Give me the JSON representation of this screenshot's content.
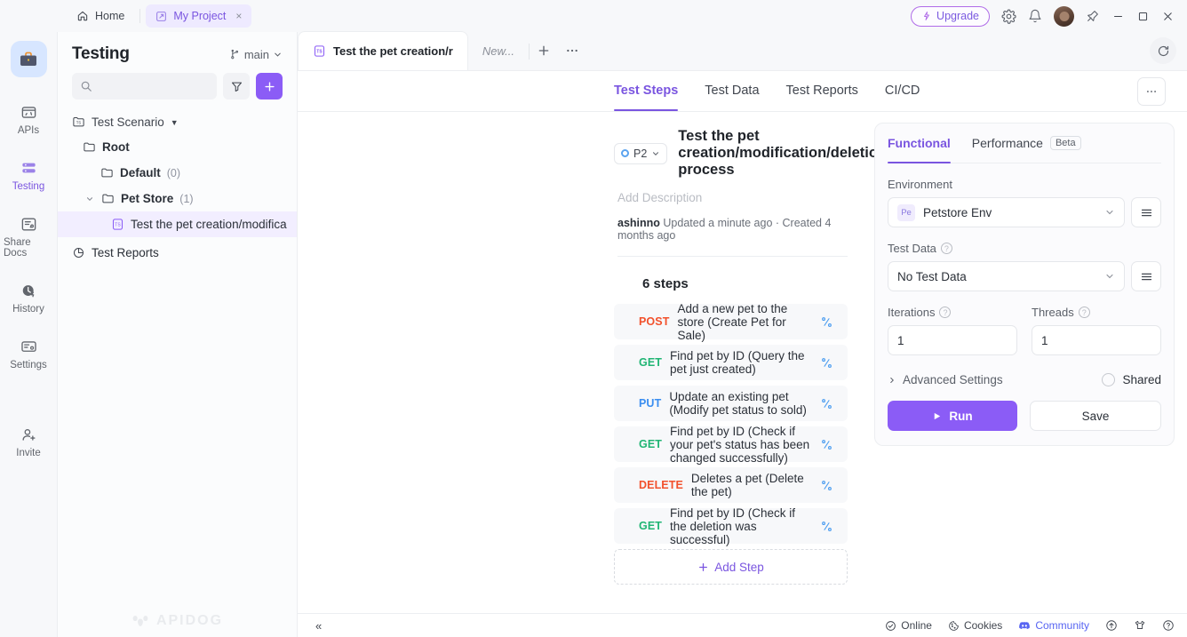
{
  "titlebar": {
    "home_label": "Home",
    "project_tab": "My Project",
    "close_label": "×",
    "upgrade_label": "Upgrade",
    "icons": {
      "settings": "gear-icon",
      "notifications": "bell-icon",
      "pin": "pin-icon"
    },
    "window": {
      "minimize": "−",
      "maximize": "□",
      "close": "✕"
    }
  },
  "rail": {
    "logo": "briefcase-icon",
    "items": [
      {
        "label": "APIs",
        "icon": "api-icon",
        "active": false
      },
      {
        "label": "Testing",
        "icon": "testing-icon",
        "active": true
      },
      {
        "label": "Share Docs",
        "icon": "share-docs-icon",
        "active": false
      },
      {
        "label": "History",
        "icon": "history-icon",
        "active": false
      },
      {
        "label": "Settings",
        "icon": "settings-icon",
        "active": false
      },
      {
        "label": "Invite",
        "icon": "invite-icon",
        "active": false
      }
    ]
  },
  "sidebar": {
    "title": "Testing",
    "branch": "main",
    "search_placeholder": "",
    "filter_icon": "filter-icon",
    "add_label": "+",
    "section": "Test Scenario",
    "tree": [
      {
        "label": "Root",
        "count": "",
        "indent": 1,
        "caret": "",
        "selected": false,
        "icon": "folder-icon"
      },
      {
        "label": "Default",
        "count": "(0)",
        "indent": 2,
        "caret": "",
        "selected": false,
        "icon": "folder-icon"
      },
      {
        "label": "Pet Store",
        "count": "(1)",
        "indent": 2,
        "caret": "⌄",
        "selected": false,
        "icon": "folder-icon"
      },
      {
        "label": "Test the pet creation/modifica",
        "count": "",
        "indent": 3,
        "caret": "",
        "selected": true,
        "icon": "test-scenario-icon"
      }
    ],
    "reports": "Test Reports",
    "watermark": "APIDOG"
  },
  "doc_tabs": {
    "tabs": [
      {
        "label": "Test the pet creation/r",
        "active": true
      },
      {
        "label": "New...",
        "active": false
      }
    ],
    "new_tab": "+",
    "more": "···",
    "refresh_icon": "refresh-icon"
  },
  "subtabs": {
    "items": [
      {
        "label": "Test Steps",
        "active": true
      },
      {
        "label": "Test Data",
        "active": false
      },
      {
        "label": "Test Reports",
        "active": false
      },
      {
        "label": "CI/CD",
        "active": false
      }
    ],
    "more": "···"
  },
  "scenario": {
    "priority": "P2",
    "title": "Test the pet creation/modification/deletion process",
    "description_placeholder": "Add Description",
    "author": "ashinno",
    "meta": "Updated a minute ago · Created 4 months ago",
    "steps_count": "6 steps",
    "add_step": "Add Step",
    "steps": [
      {
        "verb": "POST",
        "color": "#f2512c",
        "desc": "Add a new pet to the store (Create Pet for Sale)"
      },
      {
        "verb": "GET",
        "color": "#20b574",
        "desc": "Find pet by ID (Query the pet just created)"
      },
      {
        "verb": "PUT",
        "color": "#3b8ef0",
        "desc": "Update an existing pet (Modify pet status to sold)"
      },
      {
        "verb": "GET",
        "color": "#20b574",
        "desc": "Find pet by ID (Check if your pet's status has been changed successfully)"
      },
      {
        "verb": "DELETE",
        "color": "#f2512c",
        "desc": "Deletes a pet (Delete the pet)"
      },
      {
        "verb": "GET",
        "color": "#20b574",
        "desc": "Find pet by ID (Check if the deletion was successful)"
      }
    ]
  },
  "runpanel": {
    "tabs": [
      {
        "label": "Functional",
        "active": true,
        "badge": ""
      },
      {
        "label": "Performance",
        "active": false,
        "badge": "Beta"
      }
    ],
    "environment_label": "Environment",
    "environment_chip": "Pe",
    "environment_value": "Petstore Env",
    "test_data_label": "Test Data",
    "test_data_value": "No Test Data",
    "iterations_label": "Iterations",
    "iterations_value": "1",
    "threads_label": "Threads",
    "threads_value": "1",
    "advanced_label": "Advanced Settings",
    "shared_label": "Shared",
    "run_label": "Run",
    "save_label": "Save"
  },
  "statusbar": {
    "collapse": "«",
    "online": "Online",
    "cookies": "Cookies",
    "community": "Community",
    "community_color": "#5865f2"
  }
}
